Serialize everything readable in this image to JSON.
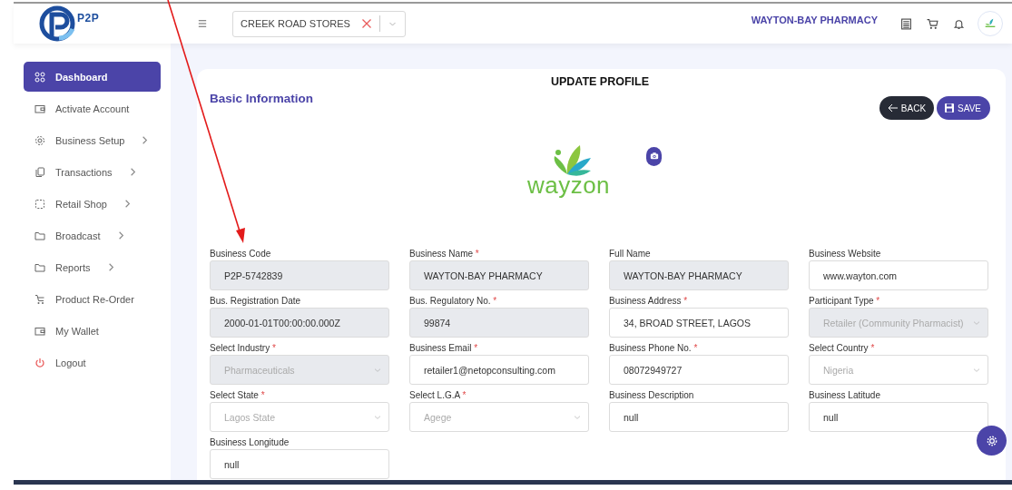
{
  "header": {
    "brand": "P2P",
    "store_select": {
      "value": "CREEK ROAD STORES"
    },
    "account_name": "WAYTON-BAY PHARMACY"
  },
  "sidebar": {
    "items": [
      {
        "label": "Dashboard",
        "selected": true,
        "submenu": false
      },
      {
        "label": "Activate Account",
        "selected": false,
        "submenu": false
      },
      {
        "label": "Business Setup",
        "selected": false,
        "submenu": true
      },
      {
        "label": "Transactions",
        "selected": false,
        "submenu": true
      },
      {
        "label": "Retail Shop",
        "selected": false,
        "submenu": true
      },
      {
        "label": "Broadcast",
        "selected": false,
        "submenu": true
      },
      {
        "label": "Reports",
        "selected": false,
        "submenu": true
      },
      {
        "label": "Product Re-Order",
        "selected": false,
        "submenu": false
      },
      {
        "label": "My Wallet",
        "selected": false,
        "submenu": false
      },
      {
        "label": "Logout",
        "selected": false,
        "submenu": false
      }
    ]
  },
  "page": {
    "title": "UPDATE PROFILE",
    "section_title": "Basic Information",
    "buttons": [
      {
        "kind": "back",
        "label": "BACK"
      },
      {
        "kind": "save",
        "label": "SAVE"
      }
    ],
    "logo_text": "wayzon",
    "fields": [
      {
        "label": "Business Code",
        "kind": "text",
        "value": "P2P-5742839",
        "disabled": true
      },
      {
        "label": "Business Name",
        "required_mark": "*",
        "kind": "text",
        "value": "WAYTON-BAY PHARMACY",
        "disabled": true
      },
      {
        "label": "Full Name",
        "kind": "text",
        "value": "WAYTON-BAY PHARMACY",
        "disabled": true
      },
      {
        "label": "Business Website",
        "kind": "text",
        "value": "www.wayton.com",
        "disabled": false
      },
      {
        "label": "Bus. Registration Date",
        "kind": "text",
        "value": "2000-01-01T00:00:00.000Z",
        "disabled": true
      },
      {
        "label": "Bus. Regulatory No.",
        "required_mark": "*",
        "kind": "text",
        "value": "99874",
        "disabled": true
      },
      {
        "label": "Business Address",
        "required_mark": "*",
        "kind": "text",
        "value": "34, BROAD STREET, LAGOS",
        "disabled": false
      },
      {
        "label": "Participant Type",
        "required_mark": "*",
        "kind": "select",
        "value": "Retailer (Community Pharmacist)",
        "disabled": true
      },
      {
        "label": "Select Industry",
        "required_mark": "*",
        "kind": "select",
        "value": "Pharmaceuticals",
        "disabled": true
      },
      {
        "label": "Business Email",
        "required_mark": "*",
        "kind": "text",
        "value": "retailer1@netopconsulting.com",
        "disabled": false
      },
      {
        "label": "Business Phone No.",
        "required_mark": "*",
        "kind": "text",
        "value": "08072949727",
        "disabled": false
      },
      {
        "label": "Select Country",
        "required_mark": "*",
        "kind": "select",
        "value": "Nigeria",
        "disabled": false
      },
      {
        "label": "Select State",
        "required_mark": "*",
        "kind": "select",
        "value": "Lagos State",
        "disabled": false
      },
      {
        "label": "Select L.G.A",
        "required_mark": "*",
        "kind": "select",
        "value": "Agege",
        "disabled": false
      },
      {
        "label": "Business Description",
        "kind": "text",
        "value": "null",
        "disabled": false
      },
      {
        "label": "Business Latitude",
        "kind": "text",
        "value": "null",
        "disabled": false
      },
      {
        "label": "Business Longitude",
        "kind": "text",
        "value": "null",
        "disabled": false
      }
    ]
  },
  "annotation": {
    "kind": "arrow"
  }
}
